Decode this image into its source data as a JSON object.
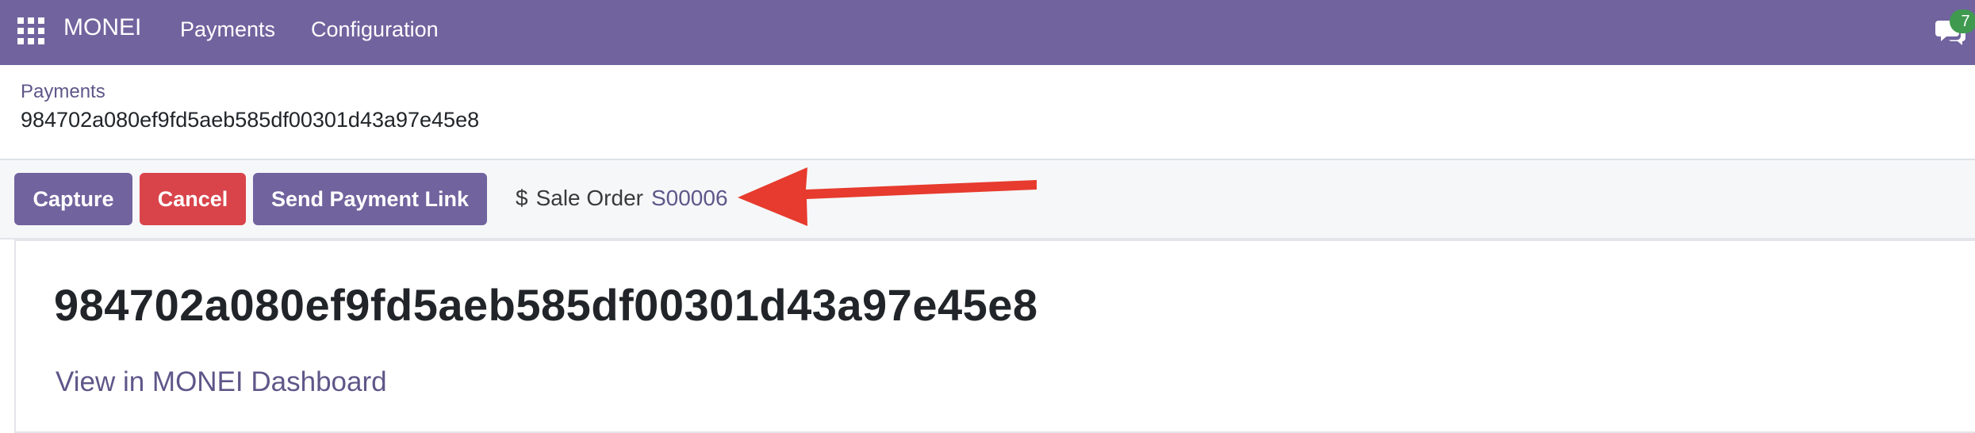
{
  "navbar": {
    "brand": "MONEI",
    "menu": [
      "Payments",
      "Configuration"
    ],
    "chat_badge": "7",
    "bg_color": "#71639e"
  },
  "breadcrumb": {
    "parent": "Payments",
    "record": "984702a080ef9fd5aeb585df00301d43a97e45e8"
  },
  "actions": {
    "capture": "Capture",
    "cancel": "Cancel",
    "send_link": "Send Payment Link"
  },
  "smart_button": {
    "icon": "dollar-icon",
    "label": "Sale Order",
    "value": "S00006"
  },
  "form": {
    "title": "984702a080ef9fd5aeb585df00301d43a97e45e8",
    "dashboard_link": "View in MONEI Dashboard"
  },
  "annotation": {
    "arrow_color": "#e63b2e"
  }
}
